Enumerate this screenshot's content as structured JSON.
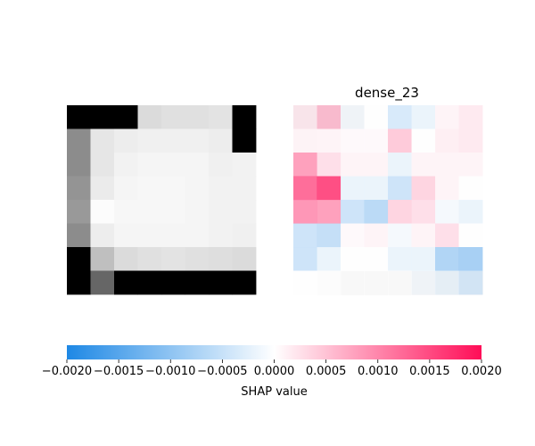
{
  "chart_data": {
    "type": "heatmap",
    "panels": [
      {
        "name": "input-image",
        "title": "",
        "grid_size": [
          8,
          8
        ],
        "colormap": "grayscale",
        "values": [
          [
            0.0,
            0.0,
            0.0,
            0.86,
            0.88,
            0.88,
            0.89,
            0.0
          ],
          [
            0.55,
            0.9,
            0.93,
            0.94,
            0.94,
            0.94,
            0.93,
            0.0
          ],
          [
            0.55,
            0.9,
            0.95,
            0.96,
            0.96,
            0.96,
            0.94,
            0.95
          ],
          [
            0.58,
            0.92,
            0.96,
            0.97,
            0.97,
            0.96,
            0.95,
            0.95
          ],
          [
            0.6,
            0.99,
            0.97,
            0.97,
            0.97,
            0.96,
            0.95,
            0.95
          ],
          [
            0.55,
            0.93,
            0.96,
            0.96,
            0.96,
            0.96,
            0.95,
            0.94
          ],
          [
            0.0,
            0.75,
            0.86,
            0.88,
            0.89,
            0.88,
            0.87,
            0.86
          ],
          [
            0.0,
            0.4,
            0.0,
            0.0,
            0.0,
            0.0,
            0.0,
            0.0
          ]
        ]
      },
      {
        "name": "shap-map",
        "title": "dense_23",
        "grid_size": [
          8,
          8
        ],
        "colormap": "shap",
        "background_gray": [
          [
            0.8,
            0.8,
            0.8,
            0.97,
            0.97,
            0.97,
            0.97,
            0.97
          ],
          [
            0.95,
            0.97,
            0.97,
            0.97,
            0.97,
            0.97,
            0.97,
            0.97
          ],
          [
            0.97,
            0.97,
            0.97,
            0.97,
            0.97,
            0.97,
            0.97,
            0.97
          ],
          [
            0.97,
            0.97,
            0.97,
            0.97,
            0.97,
            0.97,
            0.97,
            0.97
          ],
          [
            0.97,
            0.97,
            0.97,
            0.97,
            0.97,
            0.97,
            0.97,
            0.97
          ],
          [
            0.97,
            0.97,
            0.97,
            0.97,
            0.97,
            0.97,
            0.97,
            0.97
          ],
          [
            0.97,
            0.97,
            0.97,
            0.97,
            0.97,
            0.97,
            0.97,
            0.97
          ],
          [
            0.97,
            0.9,
            0.8,
            0.8,
            0.8,
            0.8,
            0.8,
            0.8
          ]
        ],
        "values": [
          [
            0.0002,
            0.0006,
            -0.0001,
            0.0,
            -0.0004,
            -0.0002,
            0.0001,
            0.0002
          ],
          [
            0.0001,
            0.0001,
            5e-05,
            5e-05,
            0.0005,
            0.0,
            0.00015,
            0.0002
          ],
          [
            0.0009,
            0.0003,
            0.0001,
            0.0001,
            -0.0002,
            0.0001,
            0.0001,
            0.0001
          ],
          [
            0.0014,
            0.0017,
            -0.0002,
            -0.0002,
            -0.0005,
            0.0004,
            0.0001,
            0.0
          ],
          [
            0.001,
            0.0009,
            -0.0005,
            -0.0007,
            0.0004,
            0.0003,
            -0.0001,
            -0.0002
          ],
          [
            -0.0005,
            -0.0006,
            5e-05,
            0.0001,
            -0.0001,
            0.0001,
            0.0003,
            0.0
          ],
          [
            -0.0005,
            -0.0002,
            0.0,
            0.0,
            -0.0002,
            -0.0002,
            -0.0008,
            -0.0009
          ],
          [
            0.0,
            0.0,
            0.0,
            0.0,
            0.0,
            -0.0001,
            -0.0002,
            -0.0004
          ]
        ]
      }
    ],
    "colorbar": {
      "label": "SHAP value",
      "range": [
        -0.002,
        0.002
      ],
      "ticks": [
        -0.002,
        -0.0015,
        -0.001,
        -0.0005,
        0.0,
        0.0005,
        0.001,
        0.0015,
        0.002
      ],
      "tick_labels": [
        "−0.0020",
        "−0.0015",
        "−0.0010",
        "−0.0005",
        "0.0000",
        "0.0005",
        "0.0010",
        "0.0015",
        "0.0020"
      ],
      "color_negative": "#1e88e5",
      "color_positive": "#ff0d57",
      "color_zero": "#ffffff"
    }
  }
}
